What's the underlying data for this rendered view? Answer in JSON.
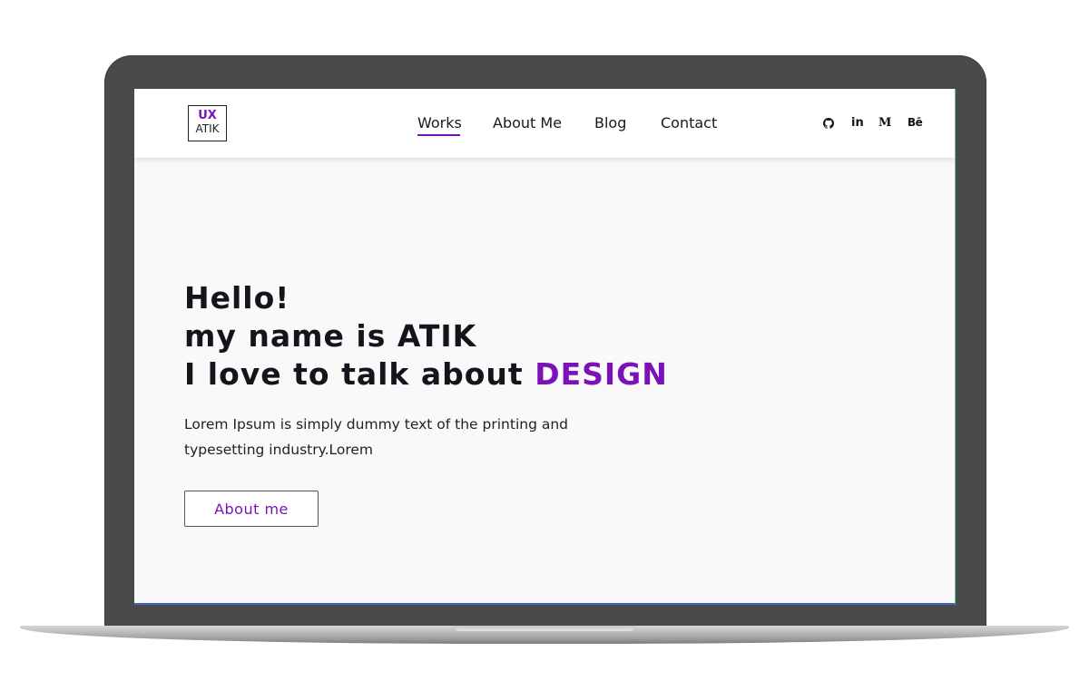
{
  "logo": {
    "top": "UX",
    "bottom": "ATIK"
  },
  "nav": {
    "items": [
      {
        "label": "Works",
        "active": true
      },
      {
        "label": "About Me",
        "active": false
      },
      {
        "label": "Blog",
        "active": false
      },
      {
        "label": "Contact",
        "active": false
      }
    ]
  },
  "social": {
    "icons": [
      "github-icon",
      "linkedin-icon",
      "medium-icon",
      "behance-icon"
    ],
    "linkedin_text": "in",
    "medium_text": "M",
    "behance_text": "Bē"
  },
  "hero": {
    "line1": "Hello!",
    "line2": "my name is ATIK",
    "line3_prefix": "I love to talk about ",
    "line3_accent": "DESIGN",
    "description": "Lorem Ipsum is simply dummy text of the printing and typesetting industry.Lorem",
    "button_label": "About me"
  },
  "colors": {
    "accent": "#7b12b8",
    "text": "#14141c",
    "bezel": "#4a4a4a",
    "screen_bg": "#f9f9f9"
  }
}
